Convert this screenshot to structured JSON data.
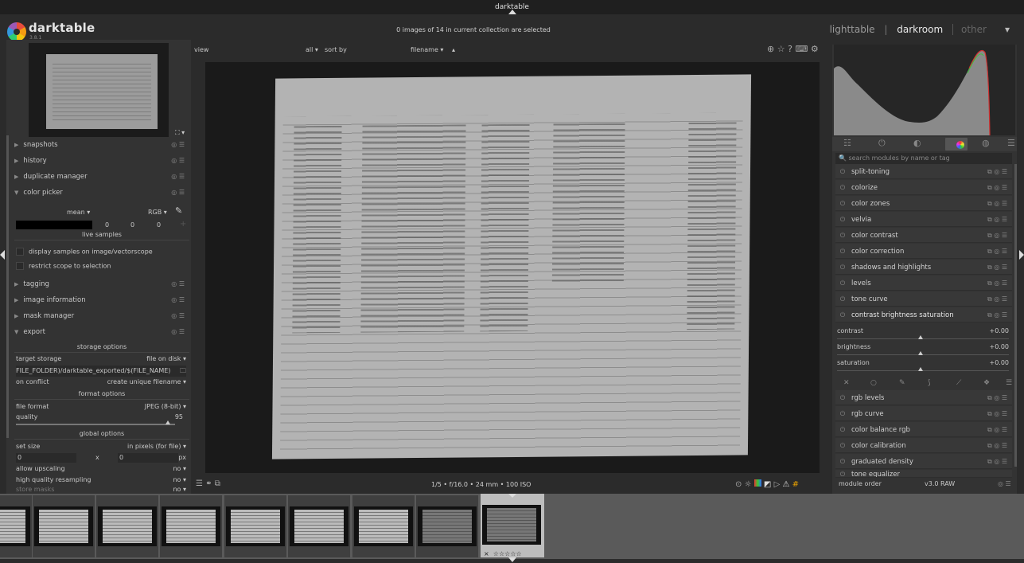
{
  "window": {
    "title": "darktable"
  },
  "header": {
    "app_name": "darktable",
    "app_version": "3.8.1",
    "collection_status": "0 images of 14 in current collection are selected",
    "views": {
      "lighttable": "lighttable",
      "darkroom": "darkroom",
      "other": "other",
      "separator": "|"
    }
  },
  "left_panel": {
    "items": [
      {
        "label": "snapshots"
      },
      {
        "label": "history"
      },
      {
        "label": "duplicate manager"
      },
      {
        "label": "color picker"
      }
    ],
    "color_picker": {
      "mode": "mean",
      "color_space": "RGB",
      "values": [
        "0",
        "0",
        "0"
      ],
      "live_samples": "live samples",
      "display_samples": "display samples on image/vectorscope",
      "restrict_scope": "restrict scope to selection"
    },
    "items2": [
      {
        "label": "tagging"
      },
      {
        "label": "image information"
      },
      {
        "label": "mask manager"
      },
      {
        "label": "export"
      }
    ],
    "export": {
      "storage_options": "storage options",
      "target_storage_label": "target storage",
      "target_storage_value": "file on disk",
      "path": "FILE_FOLDER)/darktable_exported/$(FILE_NAME)",
      "on_conflict_label": "on conflict",
      "on_conflict_value": "create unique filename",
      "format_options": "format options",
      "file_format_label": "file format",
      "file_format_value": "JPEG (8-bit)",
      "quality_label": "quality",
      "quality_value": "95",
      "global_options": "global options",
      "set_size_label": "set size",
      "set_size_value": "in pixels (for file)",
      "width": "0",
      "x": "x",
      "height": "0",
      "unit": "px",
      "upscaling_label": "allow upscaling",
      "upscaling_value": "no",
      "hq_label": "high quality resampling",
      "hq_value": "no",
      "store_masks_label": "store masks",
      "store_masks_value": "no"
    }
  },
  "center_toolbar": {
    "view": "view",
    "all": "all",
    "sort_by": "sort by",
    "filename": "filename"
  },
  "bottom_bar": {
    "info": "1/5 • f/16.0 • 24 mm • 100 ISO"
  },
  "right_panel": {
    "search_placeholder": "search modules by name or tag",
    "modules_top": [
      {
        "label": "split-toning"
      },
      {
        "label": "colorize"
      },
      {
        "label": "color zones"
      },
      {
        "label": "velvia"
      },
      {
        "label": "color contrast"
      },
      {
        "label": "color correction"
      },
      {
        "label": "shadows and highlights"
      },
      {
        "label": "levels"
      },
      {
        "label": "tone curve"
      },
      {
        "label": "contrast brightness saturation"
      }
    ],
    "sliders": [
      {
        "label": "contrast",
        "value": "+0.00"
      },
      {
        "label": "brightness",
        "value": "+0.00"
      },
      {
        "label": "saturation",
        "value": "+0.00"
      }
    ],
    "modules_bottom": [
      {
        "label": "rgb levels"
      },
      {
        "label": "rgb curve"
      },
      {
        "label": "color balance rgb"
      },
      {
        "label": "color calibration"
      },
      {
        "label": "graduated density"
      },
      {
        "label": "tone equalizer"
      }
    ],
    "module_order_label": "module order",
    "module_order_value": "v3.0 RAW"
  },
  "filmstrip": {
    "frames": 9,
    "selected_stars": "☆☆☆☆☆",
    "selected_reject": "×"
  },
  "colors": {
    "accent": "#e8e8e8",
    "panel": "#333333",
    "background": "#2b2b2b"
  }
}
